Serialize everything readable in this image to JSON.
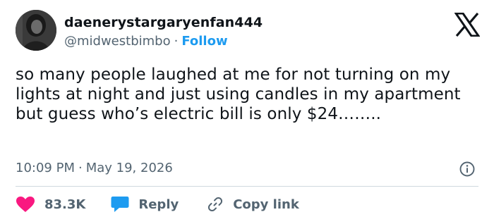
{
  "author": {
    "display_name": "daenerystargaryenfan444",
    "handle": "@midwestbimbo",
    "separator": "·",
    "follow_label": "Follow"
  },
  "tweet": {
    "text": "so many people laughed at me for not turning on my lights at night and just using candles in my apartment but guess who’s electric bill is only $24……..",
    "time": "10:09 PM",
    "separator": "·",
    "date": "May 19, 2026"
  },
  "actions": {
    "likes_count": "83.3K",
    "reply_label": "Reply",
    "copy_link_label": "Copy link"
  },
  "colors": {
    "text": "#0f1419",
    "secondary": "#536471",
    "accent_blue": "#1d9bf0",
    "like_pink": "#f91880",
    "divider": "#cfd9de"
  },
  "icons": {
    "brand": "x-logo-icon",
    "info": "info-icon",
    "like": "heart-icon",
    "reply": "speech-bubble-icon",
    "copy_link": "link-icon"
  }
}
